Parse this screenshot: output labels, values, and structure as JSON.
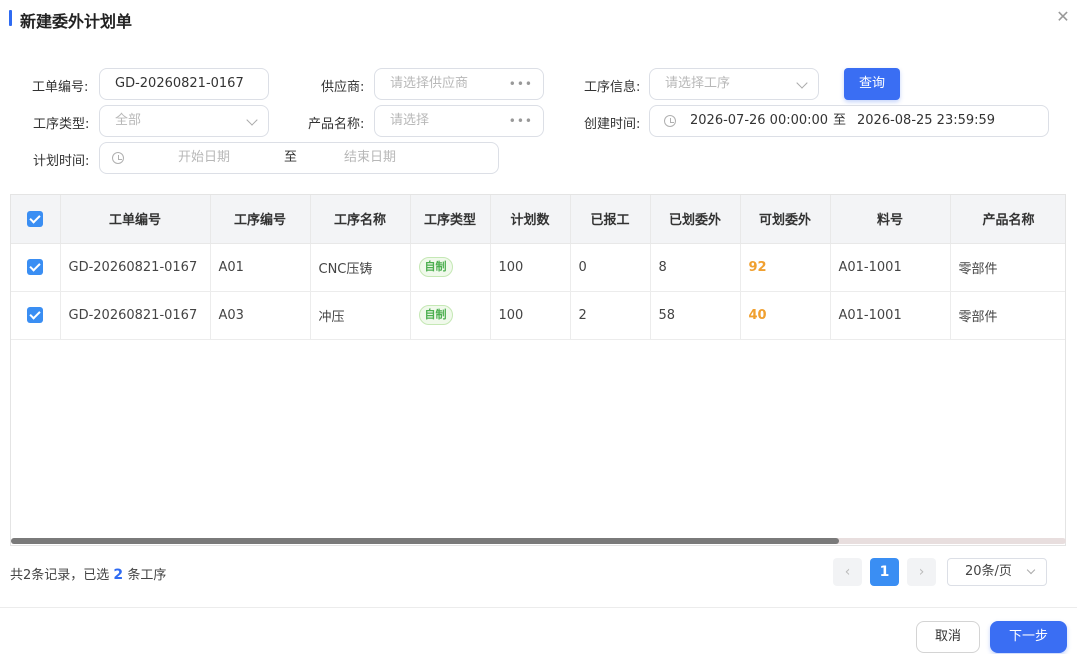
{
  "dialog": {
    "title": "新建委外计划单",
    "close_icon": "close-icon"
  },
  "filters": {
    "work_order_label": "工单编号:",
    "work_order_value": "GD-20260821-0167",
    "supplier_label": "供应商:",
    "supplier_placeholder": "请选择供应商",
    "process_info_label": "工序信息:",
    "process_info_placeholder": "请选择工序",
    "query_label": "查询",
    "process_type_label": "工序类型:",
    "process_type_placeholder": "全部",
    "product_name_label": "产品名称:",
    "product_name_placeholder": "请选择",
    "created_time_label": "创建时间:",
    "created_start": "2026-07-26 00:00:00",
    "range_separator": "至",
    "created_end": "2026-08-25 23:59:59",
    "plan_time_label": "计划时间:",
    "plan_start_placeholder": "开始日期",
    "plan_end_placeholder": "结束日期"
  },
  "table": {
    "columns": [
      "工单编号",
      "工序编号",
      "工序名称",
      "工序类型",
      "计划数",
      "已报工",
      "已划委外",
      "可划委外",
      "料号",
      "产品名称"
    ],
    "rows": [
      {
        "work_order": "GD-20260821-0167",
        "process_no": "A01",
        "process_name": "CNC压铸",
        "process_type": "自制",
        "plan_qty": "100",
        "reported": "0",
        "outsourced": "8",
        "available": "92",
        "part_no": "A01-1001",
        "product_name": "零部件",
        "checked": true
      },
      {
        "work_order": "GD-20260821-0167",
        "process_no": "A03",
        "process_name": "冲压",
        "process_type": "自制",
        "plan_qty": "100",
        "reported": "2",
        "outsourced": "58",
        "available": "40",
        "part_no": "A01-1001",
        "product_name": "零部件",
        "checked": true
      }
    ]
  },
  "footer": {
    "summary_prefix": "共2条记录，已选",
    "selected_count": "2",
    "summary_suffix": "条工序",
    "current_page": "1",
    "page_size": "20条/页",
    "cancel_label": "取消",
    "next_label": "下一步"
  },
  "colors": {
    "accent": "#3a6ef3",
    "checkbox": "#3a8ef3",
    "highlight": "#f0a030",
    "tag_green": "#4caf50"
  }
}
